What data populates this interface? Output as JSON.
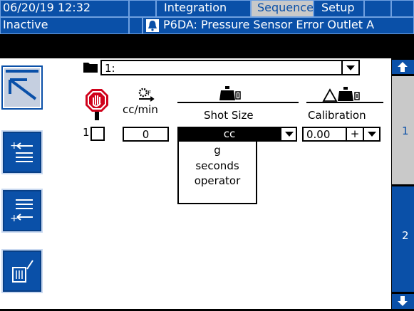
{
  "header": {
    "datetime": "06/20/19 12:32",
    "tabs": [
      {
        "label": "Integration",
        "active": false
      },
      {
        "label": "Sequence",
        "active": true
      },
      {
        "label": "Setup",
        "active": false
      }
    ],
    "status": "Inactive",
    "error": "P6DA: Pressure Sensor Error Outlet A"
  },
  "sequence": {
    "selected": "1:",
    "columns": {
      "flow_unit": "cc/min",
      "shot_size": "Shot Size",
      "calibration": "Calibration"
    },
    "row": {
      "index": "1",
      "flow_value": "0",
      "shot_unit": "cc",
      "calibration_value": "0.00",
      "calibration_sign": "+"
    },
    "shot_unit_options": [
      "g",
      "seconds",
      "operator"
    ]
  },
  "side_nav": {
    "pages": [
      "1",
      "2"
    ]
  },
  "colors": {
    "brand_blue": "#0a50a8",
    "selected_gray": "#c9c9c9",
    "stop_red": "#d0021b"
  },
  "icons": [
    "folder-icon",
    "stop-hand-icon",
    "flow-rate-icon",
    "dispense-valve-icon",
    "calibration-icon",
    "arrow-up-icon",
    "arrow-down-icon",
    "chevron-down-icon"
  ]
}
